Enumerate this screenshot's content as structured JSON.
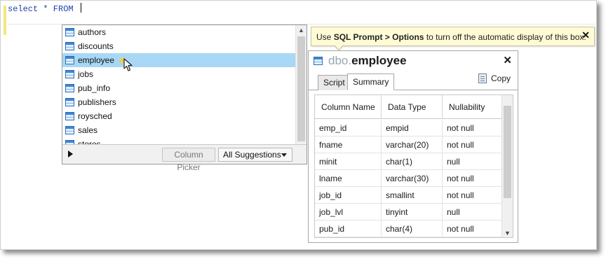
{
  "editor": {
    "query": "select * FROM "
  },
  "suggestions": {
    "items": [
      {
        "label": "authors",
        "icon": "table-icon",
        "selected": false
      },
      {
        "label": "discounts",
        "icon": "table-icon",
        "selected": false
      },
      {
        "label": "employee",
        "icon": "table-icon",
        "selected": true
      },
      {
        "label": "jobs",
        "icon": "table-icon",
        "selected": false
      },
      {
        "label": "pub_info",
        "icon": "table-icon",
        "selected": false
      },
      {
        "label": "publishers",
        "icon": "table-icon",
        "selected": false
      },
      {
        "label": "roysched",
        "icon": "table-icon",
        "selected": false
      },
      {
        "label": "sales",
        "icon": "table-icon",
        "selected": false
      },
      {
        "label": "stores",
        "icon": "table-icon",
        "selected": false
      }
    ],
    "selected_color": "#a8d8f5",
    "column_picker_label": "Column Picker",
    "filter_value": "All Suggestions"
  },
  "tooltip": {
    "prefix": "Use ",
    "bold": "SQL Prompt > Options",
    "suffix": " to turn off the automatic display of this box.",
    "close_glyph": "✕"
  },
  "detail": {
    "schema": "dbo.",
    "table": "employee",
    "close_glyph": "✕",
    "tabs": [
      {
        "label": "Script",
        "active": false
      },
      {
        "label": "Summary",
        "active": true
      }
    ],
    "copy_label": "Copy",
    "columns_header": {
      "col1": "Column Name",
      "col2": "Data Type",
      "col3": "Nullability"
    },
    "rows": [
      {
        "name": "emp_id",
        "type": "empid",
        "nullability": "not null"
      },
      {
        "name": "fname",
        "type": "varchar(20)",
        "nullability": "not null"
      },
      {
        "name": "minit",
        "type": "char(1)",
        "nullability": "null"
      },
      {
        "name": "lname",
        "type": "varchar(30)",
        "nullability": "not null"
      },
      {
        "name": "job_id",
        "type": "smallint",
        "nullability": "not null"
      },
      {
        "name": "job_lvl",
        "type": "tinyint",
        "nullability": "null"
      },
      {
        "name": "pub_id",
        "type": "char(4)",
        "nullability": "not null"
      }
    ]
  },
  "colors": {
    "sql_keyword": "#1f3fa8",
    "tooltip_bg": "#fffbd6",
    "gutter": "#f3e87a"
  }
}
